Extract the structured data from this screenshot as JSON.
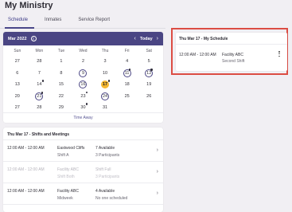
{
  "page": {
    "title": "My Ministry"
  },
  "tabs": [
    {
      "label": "Schedule",
      "active": true
    },
    {
      "label": "Inmates",
      "active": false
    },
    {
      "label": "Service Report",
      "active": false
    }
  ],
  "calendar": {
    "month": "Mar 2022",
    "info_icon": "info-icon",
    "today_label": "Today",
    "weekdays": [
      "Sun",
      "Mon",
      "Tue",
      "Wed",
      "Thu",
      "Fri",
      "Sat"
    ],
    "weeks": [
      [
        {
          "d": "27"
        },
        {
          "d": "28"
        },
        {
          "d": "1"
        },
        {
          "d": "2"
        },
        {
          "d": "3"
        },
        {
          "d": "4"
        },
        {
          "d": "5"
        }
      ],
      [
        {
          "d": "6"
        },
        {
          "d": "7"
        },
        {
          "d": "8"
        },
        {
          "d": "9",
          "circle": true
        },
        {
          "d": "10"
        },
        {
          "d": "11",
          "circle": true,
          "dot": true
        },
        {
          "d": "12",
          "circle": true,
          "dot": true
        }
      ],
      [
        {
          "d": "13"
        },
        {
          "d": "14",
          "dot": true
        },
        {
          "d": "15"
        },
        {
          "d": "16",
          "circle": true
        },
        {
          "d": "17",
          "today": true,
          "dot": true
        },
        {
          "d": "18"
        },
        {
          "d": "19"
        }
      ],
      [
        {
          "d": "20"
        },
        {
          "d": "21",
          "circle": true,
          "dot": true
        },
        {
          "d": "22"
        },
        {
          "d": "23",
          "dot": true
        },
        {
          "d": "24",
          "circle": true
        },
        {
          "d": "25"
        },
        {
          "d": "26"
        }
      ],
      [
        {
          "d": "27"
        },
        {
          "d": "28"
        },
        {
          "d": "29"
        },
        {
          "d": "30",
          "dot": true
        },
        {
          "d": "31"
        },
        {
          "d": ""
        },
        {
          "d": ""
        }
      ]
    ],
    "footer": "Time Away",
    "colors": {
      "header": "#4a4583",
      "today": "#f5b731"
    }
  },
  "shifts": {
    "title": "Thu Mar 17 - Shifts and Meetings",
    "rows": [
      {
        "time": "12:00 AM - 12:00 AM",
        "location": "Eastwood Cliffs",
        "sub": "Shift A",
        "availability": "7 Available",
        "participants": "3 Participants",
        "past": false
      },
      {
        "time": "12:00 AM - 12:00 AM",
        "location": "Facility ABC",
        "sub": "Shift Both",
        "availability": "Shift Full",
        "participants": "3 Participants",
        "past": true
      },
      {
        "time": "12:00 AM - 12:00 AM",
        "location": "Facility ABC",
        "sub": "Midweek",
        "availability": "4 Available",
        "participants": "No one scheduled",
        "past": false
      }
    ]
  },
  "my_schedule": {
    "title": "Thu Mar 17 - My Schedule",
    "entry": {
      "time": "12:00 AM - 12:00 AM",
      "location": "Facility ABC",
      "sub": "Second Shift"
    },
    "highlight_color": "#dc4d44"
  }
}
